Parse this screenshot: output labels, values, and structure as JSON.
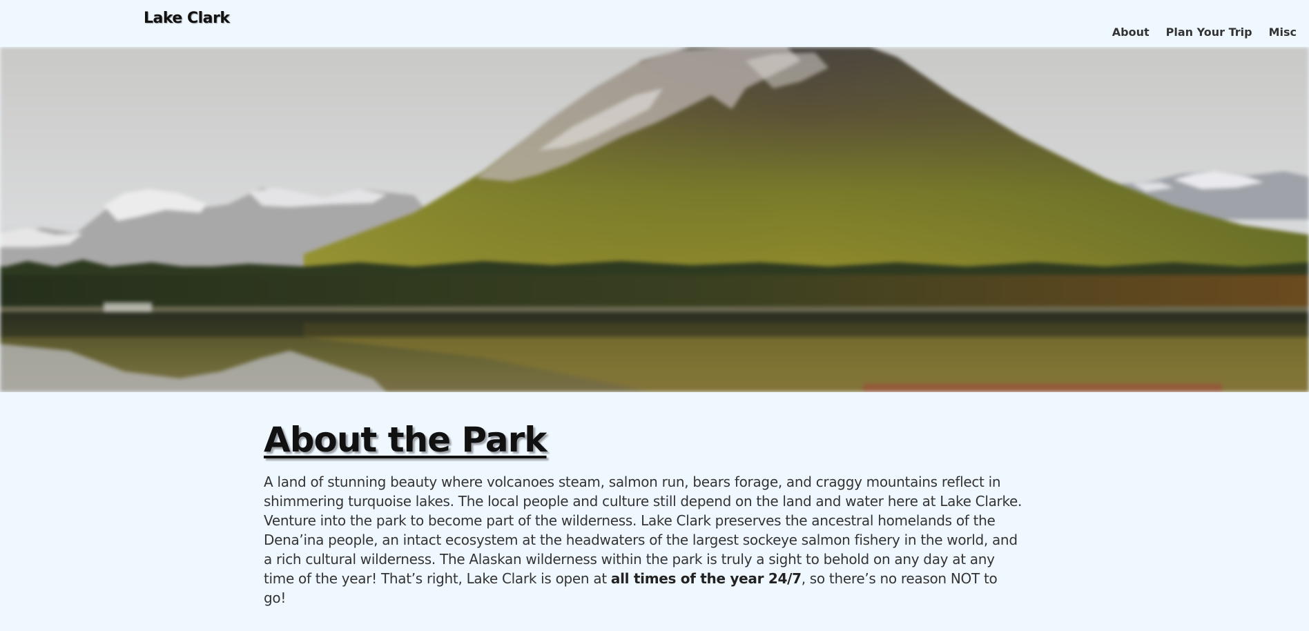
{
  "header": {
    "brand": "Lake Clark",
    "nav": [
      {
        "label": "About"
      },
      {
        "label": "Plan Your Trip"
      },
      {
        "label": "Misc"
      }
    ]
  },
  "hero": {
    "image": "mountain-lake-landscape"
  },
  "main": {
    "title": "About the Park",
    "body_before": "A land of stunning beauty where volcanoes steam, salmon run, bears forage, and craggy mountains reflect in shimmering turquoise lakes. The local people and culture still depend on the land and water here at Lake Clarke. Venture into the park to become part of the wilderness. Lake Clark preserves the ancestral homelands of the Dena’ina people, an intact ecosystem at the headwaters of the largest sockeye salmon fishery in the world, and a rich cultural wilderness. The Alaskan wilderness within the park is truly a sight to behold on any day at any time of the year! That’s right, Lake Clark is open at ",
    "body_bold": "all times of the year 24/7",
    "body_after": ", so there’s no reason NOT to go!"
  },
  "colors": {
    "background": "#f0f8ff",
    "text": "#333333",
    "heading": "#111111"
  }
}
